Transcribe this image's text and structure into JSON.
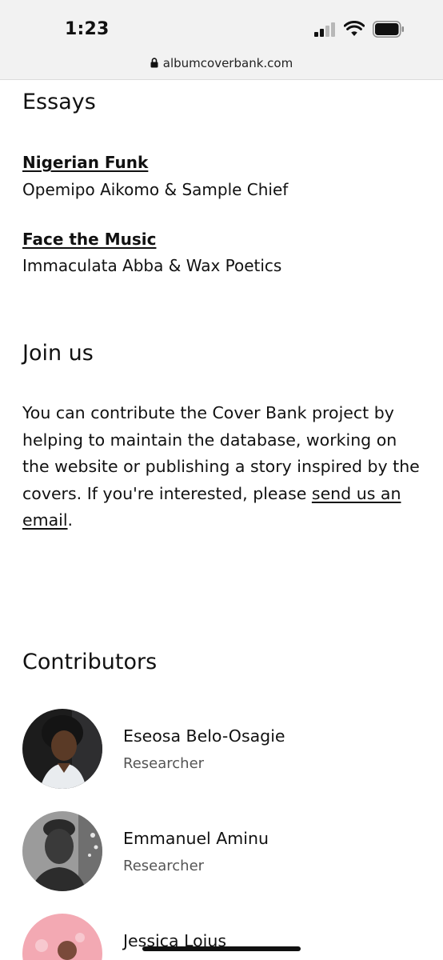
{
  "status_bar": {
    "time": "1:23",
    "url": "albumcoverbank.com",
    "icons": [
      "signal-icon",
      "wifi-icon",
      "battery-icon",
      "lock-icon"
    ]
  },
  "essays": {
    "heading": "Essays",
    "items": [
      {
        "title": "Nigerian Funk",
        "authors": "Opemipo Aikomo & Sample Chief"
      },
      {
        "title": "Face the Music",
        "authors": "Immaculata Abba & Wax Poetics"
      }
    ]
  },
  "join": {
    "heading": "Join us",
    "text": "You can contribute the Cover Bank project by helping to maintain the database, working on the website or publishing a story inspired by the covers. If you're interested, please ",
    "link_label": "send us an email",
    "text_end": "."
  },
  "contributors": {
    "heading": "Contributors",
    "items": [
      {
        "name": "Eseosa Belo-Osagie",
        "role": "Researcher"
      },
      {
        "name": "Emmanuel Aminu",
        "role": "Researcher"
      },
      {
        "name": "Jessica Loius",
        "role": ""
      }
    ]
  },
  "colors": {
    "text": "#111111",
    "muted": "#555555",
    "status_bar_bg": "#f2f2f2"
  }
}
